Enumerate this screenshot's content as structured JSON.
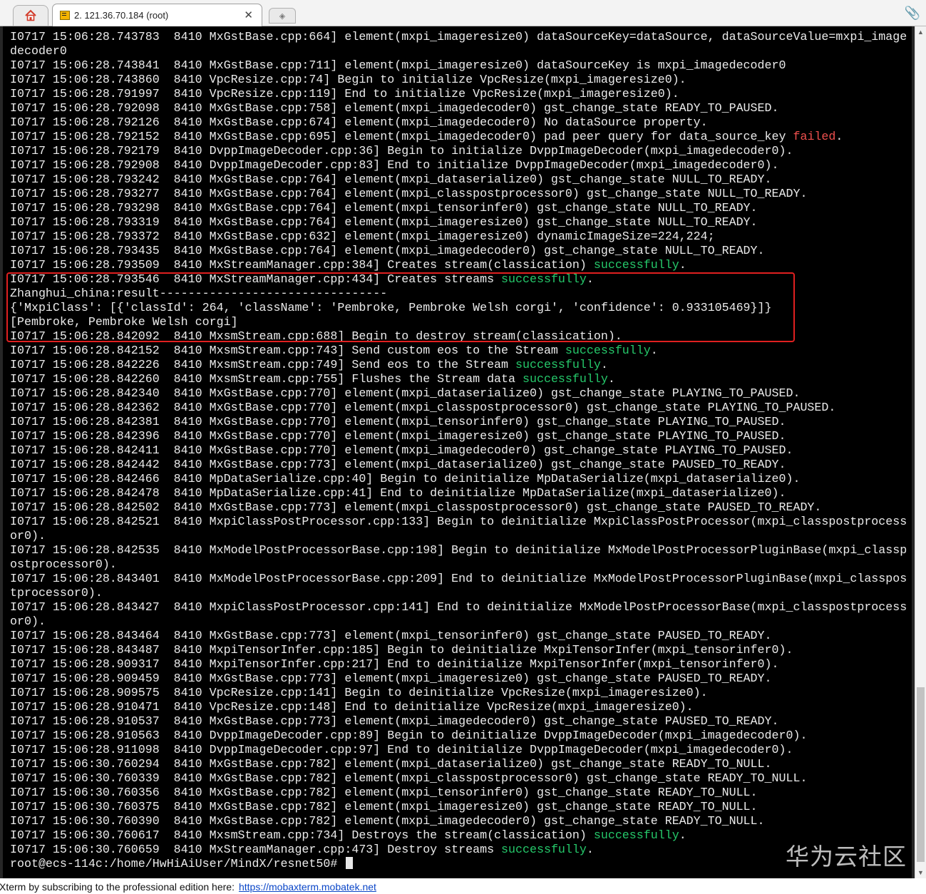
{
  "tabbar": {
    "home_icon": "home-icon",
    "session_title": "2. 121.36.70.184 (root)",
    "close_label": "✕",
    "attach_icon": "paperclip-icon"
  },
  "terminal": {
    "highlight_color": "#e02020",
    "success_color": "#25c86a",
    "failed_color": "#f0504e",
    "lines": [
      [
        {
          "t": "I0717 15:06:28.743783  8410 MxGstBase.cpp:664] element(mxpi_imageresize0) dataSourceKey=dataSource, dataSourceValue=mxpi_image"
        }
      ],
      [
        {
          "t": "decoder0"
        }
      ],
      [
        {
          "t": "I0717 15:06:28.743841  8410 MxGstBase.cpp:711] element(mxpi_imageresize0) dataSourceKey is mxpi_imagedecoder0"
        }
      ],
      [
        {
          "t": "I0717 15:06:28.743860  8410 VpcResize.cpp:74] Begin to initialize VpcResize(mxpi_imageresize0)."
        }
      ],
      [
        {
          "t": "I0717 15:06:28.791997  8410 VpcResize.cpp:119] End to initialize VpcResize(mxpi_imageresize0)."
        }
      ],
      [
        {
          "t": "I0717 15:06:28.792098  8410 MxGstBase.cpp:758] element(mxpi_imagedecoder0) gst_change_state READY_TO_PAUSED."
        }
      ],
      [
        {
          "t": "I0717 15:06:28.792126  8410 MxGstBase.cpp:674] element(mxpi_imagedecoder0) No dataSource property."
        }
      ],
      [
        {
          "t": "I0717 15:06:28.792152  8410 MxGstBase.cpp:695] element(mxpi_imagedecoder0) pad peer query for data_source_key "
        },
        {
          "t": "failed",
          "c": "bad"
        },
        {
          "t": "."
        }
      ],
      [
        {
          "t": "I0717 15:06:28.792179  8410 DvppImageDecoder.cpp:36] Begin to initialize DvppImageDecoder(mxpi_imagedecoder0)."
        }
      ],
      [
        {
          "t": "I0717 15:06:28.792908  8410 DvppImageDecoder.cpp:83] End to initialize DvppImageDecoder(mxpi_imagedecoder0)."
        }
      ],
      [
        {
          "t": "I0717 15:06:28.793242  8410 MxGstBase.cpp:764] element(mxpi_dataserialize0) gst_change_state NULL_TO_READY."
        }
      ],
      [
        {
          "t": "I0717 15:06:28.793277  8410 MxGstBase.cpp:764] element(mxpi_classpostprocessor0) gst_change_state NULL_TO_READY."
        }
      ],
      [
        {
          "t": "I0717 15:06:28.793298  8410 MxGstBase.cpp:764] element(mxpi_tensorinfer0) gst_change_state NULL_TO_READY."
        }
      ],
      [
        {
          "t": "I0717 15:06:28.793319  8410 MxGstBase.cpp:764] element(mxpi_imageresize0) gst_change_state NULL_TO_READY."
        }
      ],
      [
        {
          "t": "I0717 15:06:28.793372  8410 MxGstBase.cpp:632] element(mxpi_imageresize0) dynamicImageSize=224,224;"
        }
      ],
      [
        {
          "t": "I0717 15:06:28.793435  8410 MxGstBase.cpp:764] element(mxpi_imagedecoder0) gst_change_state NULL_TO_READY."
        }
      ],
      [
        {
          "t": "I0717 15:06:28.793509  8410 MxStreamManager.cpp:384] Creates stream(classication) "
        },
        {
          "t": "successfully",
          "c": "ok"
        },
        {
          "t": "."
        }
      ],
      [
        {
          "t": "I0717 15:06:28.793546  8410 MxStreamManager.cpp:434] Creates streams "
        },
        {
          "t": "successfully",
          "c": "ok"
        },
        {
          "t": "."
        }
      ],
      [
        {
          "t": "Zhanghui_china:result--------------------------------"
        }
      ],
      [
        {
          "t": "{'MxpiClass': [{'classId': 264, 'className': 'Pembroke, Pembroke Welsh corgi', 'confidence': 0.933105469}]}"
        }
      ],
      [
        {
          "t": "[Pembroke, Pembroke Welsh corgi]"
        }
      ],
      [
        {
          "t": "I0717 15:06:28.842092  8410 MxsmStream.cpp:688] Begin to destroy stream(classication)."
        }
      ],
      [
        {
          "t": "I0717 15:06:28.842152  8410 MxsmStream.cpp:743] Send custom eos to the Stream "
        },
        {
          "t": "successfully",
          "c": "ok"
        },
        {
          "t": "."
        }
      ],
      [
        {
          "t": "I0717 15:06:28.842226  8410 MxsmStream.cpp:749] Send eos to the Stream "
        },
        {
          "t": "successfully",
          "c": "ok"
        },
        {
          "t": "."
        }
      ],
      [
        {
          "t": "I0717 15:06:28.842260  8410 MxsmStream.cpp:755] Flushes the Stream data "
        },
        {
          "t": "successfully",
          "c": "ok"
        },
        {
          "t": "."
        }
      ],
      [
        {
          "t": "I0717 15:06:28.842340  8410 MxGstBase.cpp:770] element(mxpi_dataserialize0) gst_change_state PLAYING_TO_PAUSED."
        }
      ],
      [
        {
          "t": "I0717 15:06:28.842362  8410 MxGstBase.cpp:770] element(mxpi_classpostprocessor0) gst_change_state PLAYING_TO_PAUSED."
        }
      ],
      [
        {
          "t": "I0717 15:06:28.842381  8410 MxGstBase.cpp:770] element(mxpi_tensorinfer0) gst_change_state PLAYING_TO_PAUSED."
        }
      ],
      [
        {
          "t": "I0717 15:06:28.842396  8410 MxGstBase.cpp:770] element(mxpi_imageresize0) gst_change_state PLAYING_TO_PAUSED."
        }
      ],
      [
        {
          "t": "I0717 15:06:28.842411  8410 MxGstBase.cpp:770] element(mxpi_imagedecoder0) gst_change_state PLAYING_TO_PAUSED."
        }
      ],
      [
        {
          "t": "I0717 15:06:28.842442  8410 MxGstBase.cpp:773] element(mxpi_dataserialize0) gst_change_state PAUSED_TO_READY."
        }
      ],
      [
        {
          "t": "I0717 15:06:28.842466  8410 MpDataSerialize.cpp:40] Begin to deinitialize MpDataSerialize(mxpi_dataserialize0)."
        }
      ],
      [
        {
          "t": "I0717 15:06:28.842478  8410 MpDataSerialize.cpp:41] End to deinitialize MpDataSerialize(mxpi_dataserialize0)."
        }
      ],
      [
        {
          "t": "I0717 15:06:28.842502  8410 MxGstBase.cpp:773] element(mxpi_classpostprocessor0) gst_change_state PAUSED_TO_READY."
        }
      ],
      [
        {
          "t": "I0717 15:06:28.842521  8410 MxpiClassPostProcessor.cpp:133] Begin to deinitialize MxpiClassPostProcessor(mxpi_classpostprocess"
        }
      ],
      [
        {
          "t": "or0)."
        }
      ],
      [
        {
          "t": "I0717 15:06:28.842535  8410 MxModelPostProcessorBase.cpp:198] Begin to deinitialize MxModelPostProcessorPluginBase(mxpi_classp"
        }
      ],
      [
        {
          "t": "ostprocessor0)."
        }
      ],
      [
        {
          "t": "I0717 15:06:28.843401  8410 MxModelPostProcessorBase.cpp:209] End to deinitialize MxModelPostProcessorPluginBase(mxpi_classpos"
        }
      ],
      [
        {
          "t": "tprocessor0)."
        }
      ],
      [
        {
          "t": "I0717 15:06:28.843427  8410 MxpiClassPostProcessor.cpp:141] End to deinitialize MxModelPostProcessorBase(mxpi_classpostprocess"
        }
      ],
      [
        {
          "t": "or0)."
        }
      ],
      [
        {
          "t": "I0717 15:06:28.843464  8410 MxGstBase.cpp:773] element(mxpi_tensorinfer0) gst_change_state PAUSED_TO_READY."
        }
      ],
      [
        {
          "t": "I0717 15:06:28.843487  8410 MxpiTensorInfer.cpp:185] Begin to deinitialize MxpiTensorInfer(mxpi_tensorinfer0)."
        }
      ],
      [
        {
          "t": "I0717 15:06:28.909317  8410 MxpiTensorInfer.cpp:217] End to deinitialize MxpiTensorInfer(mxpi_tensorinfer0)."
        }
      ],
      [
        {
          "t": "I0717 15:06:28.909459  8410 MxGstBase.cpp:773] element(mxpi_imageresize0) gst_change_state PAUSED_TO_READY."
        }
      ],
      [
        {
          "t": "I0717 15:06:28.909575  8410 VpcResize.cpp:141] Begin to deinitialize VpcResize(mxpi_imageresize0)."
        }
      ],
      [
        {
          "t": "I0717 15:06:28.910471  8410 VpcResize.cpp:148] End to deinitialize VpcResize(mxpi_imageresize0)."
        }
      ],
      [
        {
          "t": "I0717 15:06:28.910537  8410 MxGstBase.cpp:773] element(mxpi_imagedecoder0) gst_change_state PAUSED_TO_READY."
        }
      ],
      [
        {
          "t": "I0717 15:06:28.910563  8410 DvppImageDecoder.cpp:89] Begin to deinitialize DvppImageDecoder(mxpi_imagedecoder0)."
        }
      ],
      [
        {
          "t": "I0717 15:06:28.911098  8410 DvppImageDecoder.cpp:97] End to deinitialize DvppImageDecoder(mxpi_imagedecoder0)."
        }
      ],
      [
        {
          "t": "I0717 15:06:30.760294  8410 MxGstBase.cpp:782] element(mxpi_dataserialize0) gst_change_state READY_TO_NULL."
        }
      ],
      [
        {
          "t": "I0717 15:06:30.760339  8410 MxGstBase.cpp:782] element(mxpi_classpostprocessor0) gst_change_state READY_TO_NULL."
        }
      ],
      [
        {
          "t": "I0717 15:06:30.760356  8410 MxGstBase.cpp:782] element(mxpi_tensorinfer0) gst_change_state READY_TO_NULL."
        }
      ],
      [
        {
          "t": "I0717 15:06:30.760375  8410 MxGstBase.cpp:782] element(mxpi_imageresize0) gst_change_state READY_TO_NULL."
        }
      ],
      [
        {
          "t": "I0717 15:06:30.760390  8410 MxGstBase.cpp:782] element(mxpi_imagedecoder0) gst_change_state READY_TO_NULL."
        }
      ],
      [
        {
          "t": "I0717 15:06:30.760617  8410 MxsmStream.cpp:734] Destroys the stream(classication) "
        },
        {
          "t": "successfully",
          "c": "ok"
        },
        {
          "t": "."
        }
      ],
      [
        {
          "t": "I0717 15:06:30.760659  8410 MxStreamManager.cpp:473] Destroy streams "
        },
        {
          "t": "successfully",
          "c": "ok"
        },
        {
          "t": "."
        }
      ]
    ],
    "prompt": "root@ecs-114c:/home/HwHiAiUser/MindX/resnet50# "
  },
  "watermark": "华为云社区",
  "statusbar": {
    "message": "Xterm by subscribing to the professional edition here:",
    "link": "https://mobaxterm.mobatek.net"
  }
}
